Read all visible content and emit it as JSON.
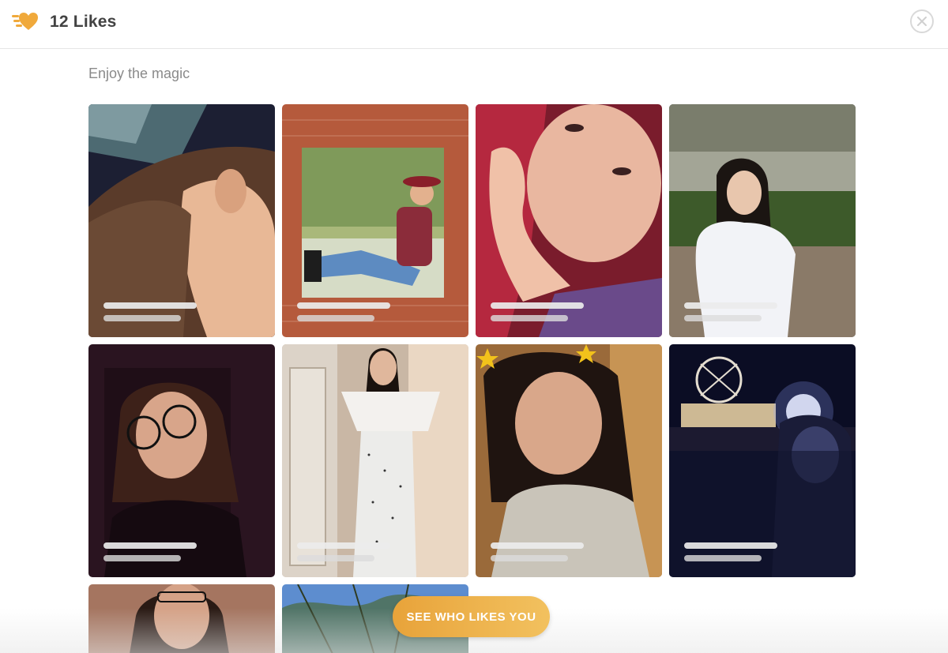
{
  "header": {
    "title": "12 Likes",
    "logo_icon": "heart-wings-icon",
    "close_icon": "close-icon",
    "accent_color": "#f0a93b"
  },
  "main": {
    "subtitle": "Enjoy the magic"
  },
  "cards": [
    {
      "photo": "woman-selfie-in-car",
      "blurred_name": true
    },
    {
      "photo": "woman-in-red-hat-sitting-in-brick-window",
      "blurred_name": true
    },
    {
      "photo": "red-haired-woman-chin-on-hand",
      "blurred_name": true
    },
    {
      "photo": "woman-in-white-top-outdoors-at-night",
      "blurred_name": true
    },
    {
      "photo": "woman-with-round-glasses-dark-background",
      "blurred_name": true
    },
    {
      "photo": "woman-in-polka-dot-jumpsuit",
      "blurred_name": true
    },
    {
      "photo": "woman-with-star-crown-filter",
      "blurred_name": true
    },
    {
      "photo": "woman-with-headlamp-at-night-festival",
      "blurred_name": true
    },
    {
      "photo": "woman-with-glasses-close-up",
      "blurred_name": true
    },
    {
      "photo": "tree-branches-blue-sky",
      "blurred_name": true
    }
  ],
  "cta": {
    "label": "SEE WHO LIKES YOU"
  }
}
